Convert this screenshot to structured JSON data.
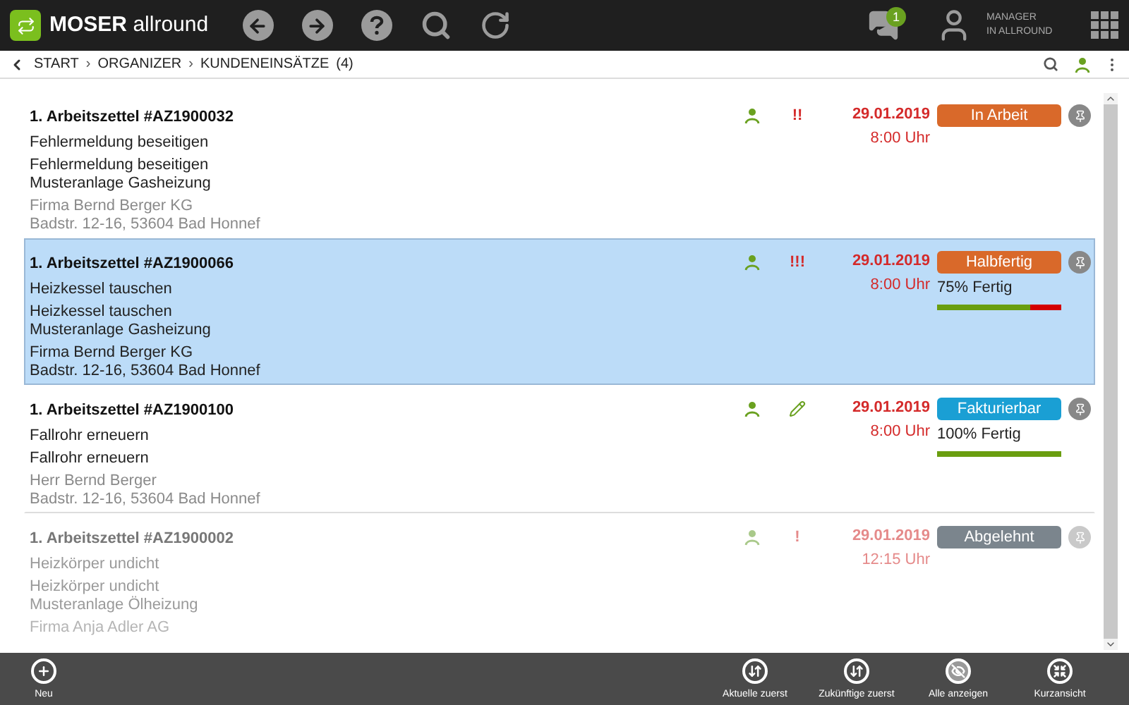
{
  "app": {
    "name_bold": "MOSER",
    "name_rest": "allround",
    "message_count": "1",
    "user_line1": "MANAGER",
    "user_line2": "IN ALLROUND"
  },
  "breadcrumb": [
    {
      "label": "START"
    },
    {
      "label": "ORGANIZER"
    },
    {
      "label": "KUNDENEINSÄTZE"
    }
  ],
  "breadcrumb_separator": "›",
  "count": "(4)",
  "items": [
    {
      "title": "1. Arbeitszettel #AZ1900032",
      "subject": "Fehlermeldung beseitigen",
      "lines": [
        "Fehlermeldung beseitigen",
        "Musteranlage Gasheizung"
      ],
      "address": [
        "Firma Bernd Berger KG",
        "Badstr. 12-16, 53604 Bad Honnef"
      ],
      "marker": {
        "kind": "priority",
        "text": "!!"
      },
      "date": "29.01.2019",
      "time": "8:00 Uhr",
      "status": {
        "label": "In Arbeit",
        "color": "#d9692a"
      },
      "selected": false,
      "disabled": false
    },
    {
      "title": "1. Arbeitszettel #AZ1900066",
      "subject": "Heizkessel tauschen",
      "lines": [
        "Heizkessel tauschen",
        "Musteranlage Gasheizung"
      ],
      "address": [
        "Firma Bernd Berger KG",
        "Badstr. 12-16, 53604 Bad Honnef"
      ],
      "marker": {
        "kind": "priority",
        "text": "!!!"
      },
      "date": "29.01.2019",
      "time": "8:00 Uhr",
      "status": {
        "label": "Halbfertig",
        "color": "#d9692a"
      },
      "progress": {
        "label": "75% Fertig",
        "level": 0.75
      },
      "selected": true,
      "disabled": false
    },
    {
      "title": "1. Arbeitszettel #AZ1900100",
      "subject": "Fallrohr erneuern",
      "lines": [
        "Fallrohr erneuern"
      ],
      "address": [
        "Herr Bernd Berger",
        "Badstr. 12-16, 53604 Bad Honnef"
      ],
      "marker": {
        "kind": "edit"
      },
      "date": "29.01.2019",
      "time": "8:00 Uhr",
      "status": {
        "label": "Fakturierbar",
        "color": "#1a9fd4"
      },
      "progress": {
        "label": "100% Fertig",
        "level": 1
      },
      "selected": false,
      "disabled": false
    },
    {
      "title": "1. Arbeitszettel #AZ1900002",
      "subject": "Heizkörper undicht",
      "lines": [
        "Heizkörper undicht",
        "Musteranlage Ölheizung"
      ],
      "address": [
        "Firma Anja Adler AG"
      ],
      "marker": {
        "kind": "priority",
        "text": "!"
      },
      "date": "29.01.2019",
      "time": "12:15 Uhr",
      "status": {
        "label": "Abgelehnt",
        "color": "#7b858d"
      },
      "selected": false,
      "disabled": true
    }
  ],
  "actions": [
    {
      "kind": "add",
      "label": "Neu"
    },
    {
      "kind": "sort-up",
      "label": "Aktuelle zuerst"
    },
    {
      "kind": "sort-down",
      "label": "Zukünftige zuerst"
    },
    {
      "kind": "eye-off",
      "label": "Alle anzeigen"
    },
    {
      "kind": "shrink",
      "label": "Kurzansicht"
    }
  ]
}
